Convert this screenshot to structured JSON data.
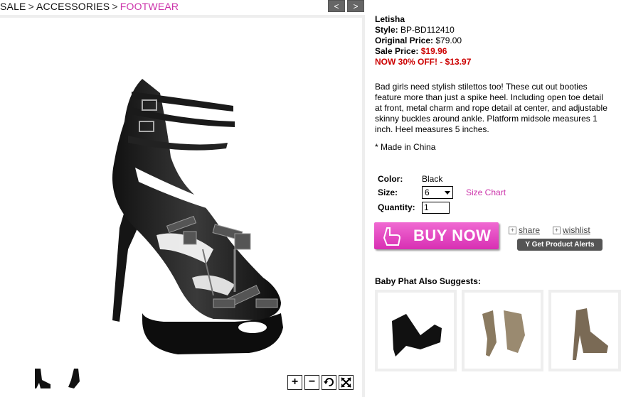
{
  "breadcrumb": {
    "items": [
      "SALE",
      "ACCESSORIES"
    ],
    "current": "FOOTWEAR",
    "separator": ">"
  },
  "nav": {
    "prev": "<",
    "next": ">"
  },
  "product": {
    "name": "Letisha",
    "style_label": "Style:",
    "style": "BP-BD112410",
    "original_label": "Original Price:",
    "original_price": "$79.00",
    "sale_label": "Sale Price:",
    "sale_price": "$19.96",
    "discount": "NOW 30% OFF! - $13.97",
    "description": "Bad girls need stylish stilettos too! These cut out booties feature more than just a spike heel. Including open toe detail at front, metal charm and rope detail at center, and adjustable skinny buckles around ankle. Platform midsole measures 1 inch. Heel measures 5 inches.",
    "made_in": "* Made in China"
  },
  "options": {
    "color_label": "Color:",
    "color": "Black",
    "size_label": "Size:",
    "size": "6",
    "size_chart": "Size Chart",
    "quantity_label": "Quantity:",
    "quantity": "1"
  },
  "actions": {
    "buy": "BUY NOW",
    "share": "share",
    "wishlist": "wishlist",
    "alerts": "Get Product Alerts"
  },
  "suggest": {
    "title": "Baby Phat Also Suggests:"
  },
  "viewer": {
    "zoom_in": "+",
    "zoom_out": "−"
  },
  "colors": {
    "accent": "#cc33aa",
    "sale": "#cc0000",
    "buy_button": "#e44cc6"
  }
}
